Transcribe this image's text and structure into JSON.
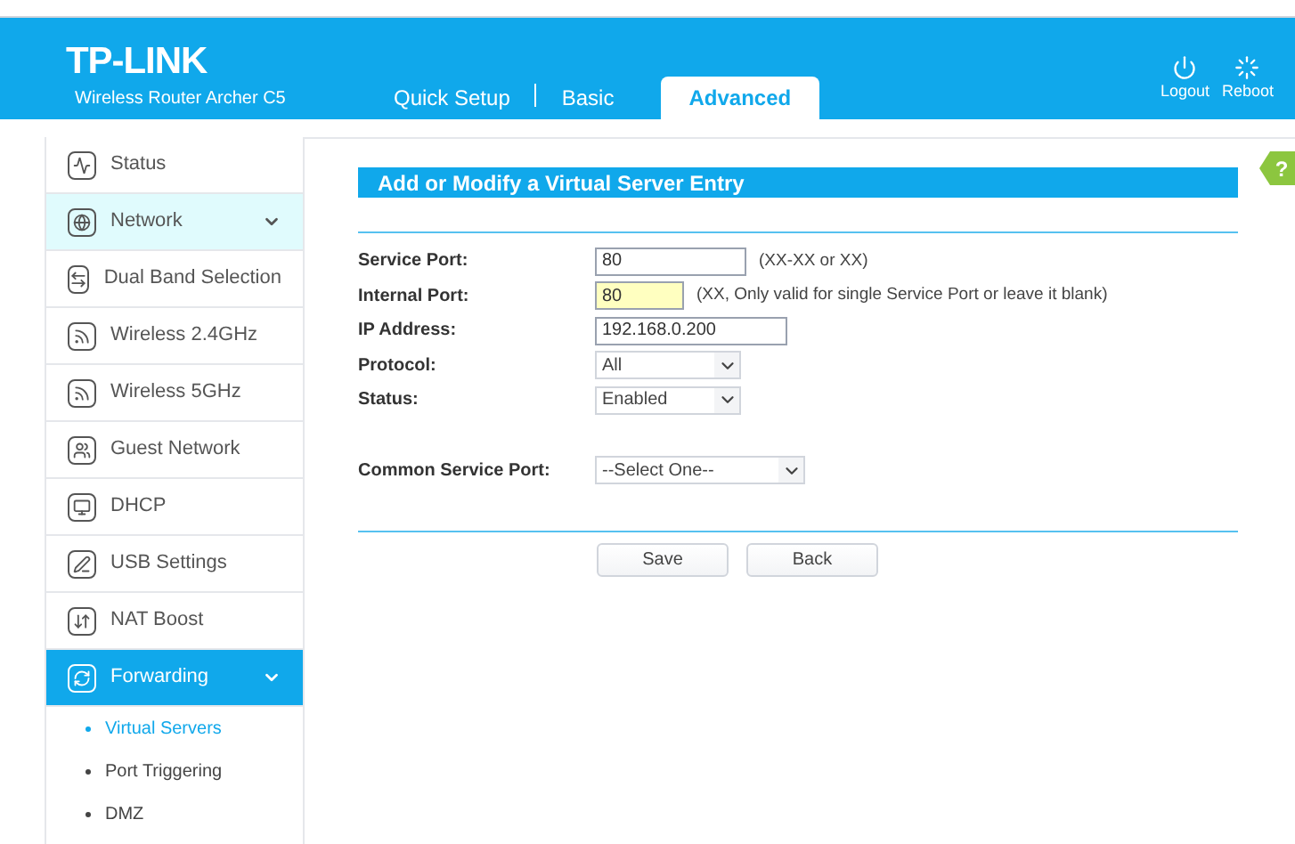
{
  "header": {
    "brand": "TP-LINK",
    "model": "Wireless Router Archer C5",
    "tabs": [
      {
        "label": "Quick Setup",
        "selected": false
      },
      {
        "label": "Basic",
        "selected": false
      },
      {
        "label": "Advanced",
        "selected": true
      }
    ],
    "actions": [
      {
        "label": "Logout",
        "kind": "logout"
      },
      {
        "label": "Reboot",
        "kind": "reboot"
      }
    ]
  },
  "sidebar": {
    "items": [
      {
        "label": "Status",
        "kind": "status",
        "selected": false
      },
      {
        "label": "Network",
        "kind": "network",
        "selected": false,
        "hovered": true,
        "expandable": true
      },
      {
        "label": "Dual Band Selection",
        "kind": "dualband",
        "selected": false
      },
      {
        "label": "Wireless 2.4GHz",
        "kind": "wireless",
        "selected": false
      },
      {
        "label": "Wireless 5GHz",
        "kind": "wireless",
        "selected": false
      },
      {
        "label": "Guest Network",
        "kind": "guest",
        "selected": false
      },
      {
        "label": "DHCP",
        "kind": "dhcp",
        "selected": false
      },
      {
        "label": "USB Settings",
        "kind": "usb",
        "selected": false
      },
      {
        "label": "NAT Boost",
        "kind": "nat",
        "selected": false
      },
      {
        "label": "Forwarding",
        "kind": "forwarding",
        "selected": true,
        "expandable": true,
        "children": [
          {
            "label": "Virtual Servers",
            "selected": true
          },
          {
            "label": "Port Triggering",
            "selected": false
          },
          {
            "label": "DMZ",
            "selected": false
          }
        ]
      }
    ]
  },
  "form": {
    "title": "Add or Modify a Virtual Server Entry",
    "help": "?",
    "fields": [
      {
        "label": "Service Port:",
        "kind": "input",
        "value": "80",
        "hint": "(XX-XX or XX)",
        "focused": false
      },
      {
        "label": "Internal Port:",
        "kind": "input",
        "value": "80",
        "hint": "(XX, Only valid for single Service Port or leave it blank)",
        "focused": true
      },
      {
        "label": "IP Address:",
        "kind": "input",
        "value": "192.168.0.200",
        "focused": false
      },
      {
        "label": "Protocol:",
        "kind": "select",
        "value": "All"
      },
      {
        "label": "Status:",
        "kind": "select",
        "value": "Enabled"
      },
      {
        "label": "Common Service Port:",
        "kind": "select",
        "value": "--Select One--"
      }
    ],
    "buttons": [
      "Save",
      "Back"
    ]
  }
}
